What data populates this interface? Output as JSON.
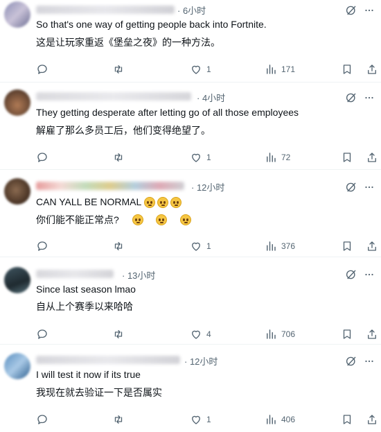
{
  "replies": [
    {
      "time": "6小时",
      "text_en": "So that's one way of getting people back into Fortnite.",
      "text_zh": "这是让玩家重返《堡垒之夜》的一种方法。",
      "likes": "1",
      "views": "171",
      "emoji_count": 0
    },
    {
      "time": "4小时",
      "text_en": "They getting desperate after letting go of all those employees",
      "text_zh": "解雇了那么多员工后，他们变得绝望了。",
      "likes": "1",
      "views": "72",
      "emoji_count": 0
    },
    {
      "time": "12小时",
      "text_en": "CAN YALL BE NORMAL",
      "text_zh": "你们能不能正常点?",
      "likes": "1",
      "views": "376",
      "emoji_count": 3
    },
    {
      "time": "13小时",
      "text_en": "Since last season lmao",
      "text_zh": "自从上个赛季以来哈哈",
      "likes": "4",
      "views": "706",
      "emoji_count": 0
    },
    {
      "time": "12小时",
      "text_en": "I will test it now if its true",
      "text_zh": "我现在就去验证一下是否属实",
      "likes": "1",
      "views": "406",
      "emoji_count": 0
    }
  ],
  "icons": {
    "reply": "reply-icon",
    "repost": "repost-icon",
    "like": "heart-icon",
    "views": "views-icon",
    "bookmark": "bookmark-icon",
    "share": "share-icon",
    "grok": "grok-icon",
    "more": "more-icon"
  },
  "colors": {
    "secondary_text": "#536471",
    "divider": "#eff3f4",
    "emoji": "#f6c643"
  }
}
